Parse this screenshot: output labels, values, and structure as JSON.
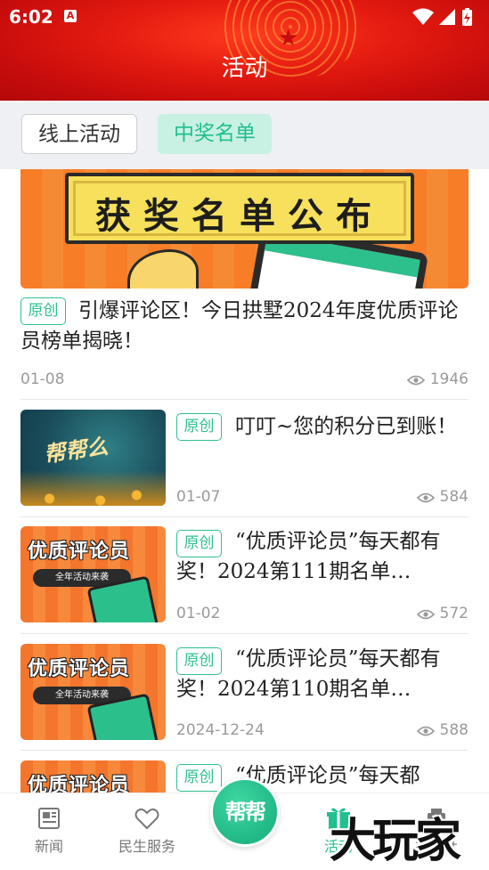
{
  "status_bar": {
    "time": "6:02",
    "a_label": "A"
  },
  "header": {
    "title": "活动"
  },
  "tabs": [
    {
      "label": "线上活动",
      "active": false
    },
    {
      "label": "中奖名单",
      "active": true
    }
  ],
  "banner": {
    "headline": "获奖名单公布"
  },
  "articles": [
    {
      "badge": "原创",
      "title": "引爆评论区！今日拱墅2024年度优质评论员榜单揭晓！",
      "date": "01-08",
      "views": "1946"
    },
    {
      "badge": "原创",
      "title": "叮叮~您的积分已到账！",
      "date": "01-07",
      "views": "584",
      "thumb_text": "帮帮么"
    },
    {
      "badge": "原创",
      "title": "“优质评论员”每天都有奖！2024第111期名单…",
      "date": "01-02",
      "views": "572",
      "thumb_title": "优质评论员",
      "thumb_pill": "全年活动来袭"
    },
    {
      "badge": "原创",
      "title": "“优质评论员”每天都有奖！2024第110期名单…",
      "date": "2024-12-24",
      "views": "588",
      "thumb_title": "优质评论员",
      "thumb_pill": "全年活动来袭"
    },
    {
      "badge": "原创",
      "title": "“优质评论员”每天都",
      "thumb_title": "优质评论员"
    }
  ],
  "bottom_nav": [
    {
      "label": "新闻",
      "icon": "newspaper-icon",
      "active": false
    },
    {
      "label": "民生服务",
      "icon": "heart-icon",
      "active": false
    },
    {
      "label": "帮帮",
      "icon": "bangbang-logo",
      "active": false
    },
    {
      "label": "活动",
      "icon": "gift-icon",
      "active": true
    },
    {
      "label": "福利社",
      "icon": "welfare-icon",
      "active": false
    }
  ],
  "watermark": "大玩家",
  "colors": {
    "brand_red": "#d51511",
    "accent_green": "#22c08f",
    "tab_active_bg": "#c9f1e3"
  }
}
